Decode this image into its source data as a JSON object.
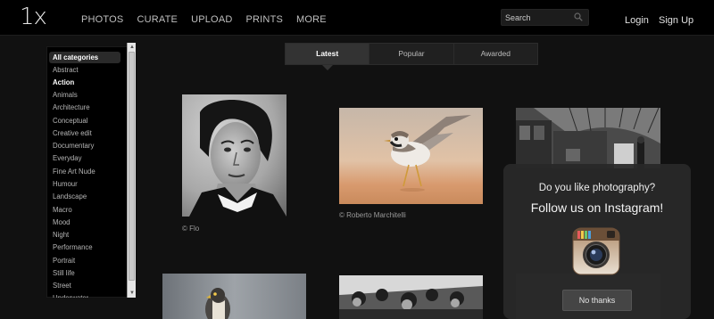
{
  "header": {
    "logo": "1x",
    "nav": [
      "PHOTOS",
      "CURATE",
      "UPLOAD",
      "PRINTS",
      "MORE"
    ],
    "search_placeholder": "Search",
    "login": "Login",
    "signup": "Sign Up"
  },
  "sidebar": {
    "categories": [
      "All categories",
      "Abstract",
      "Action",
      "Animals",
      "Architecture",
      "Conceptual",
      "Creative edit",
      "Documentary",
      "Everyday",
      "Fine Art Nude",
      "Humour",
      "Landscape",
      "Macro",
      "Mood",
      "Night",
      "Performance",
      "Portrait",
      "Still life",
      "Street",
      "Underwater"
    ],
    "selected": "All categories",
    "highlighted": "Action"
  },
  "tabs": {
    "items": [
      "Latest",
      "Popular",
      "Awarded"
    ],
    "active": "Latest"
  },
  "photos": {
    "credits": [
      "© Flo",
      "© Roberto Marchitelli"
    ]
  },
  "popup": {
    "question": "Do you like photography?",
    "follow": "Follow us on Instagram!",
    "button": "No thanks"
  }
}
